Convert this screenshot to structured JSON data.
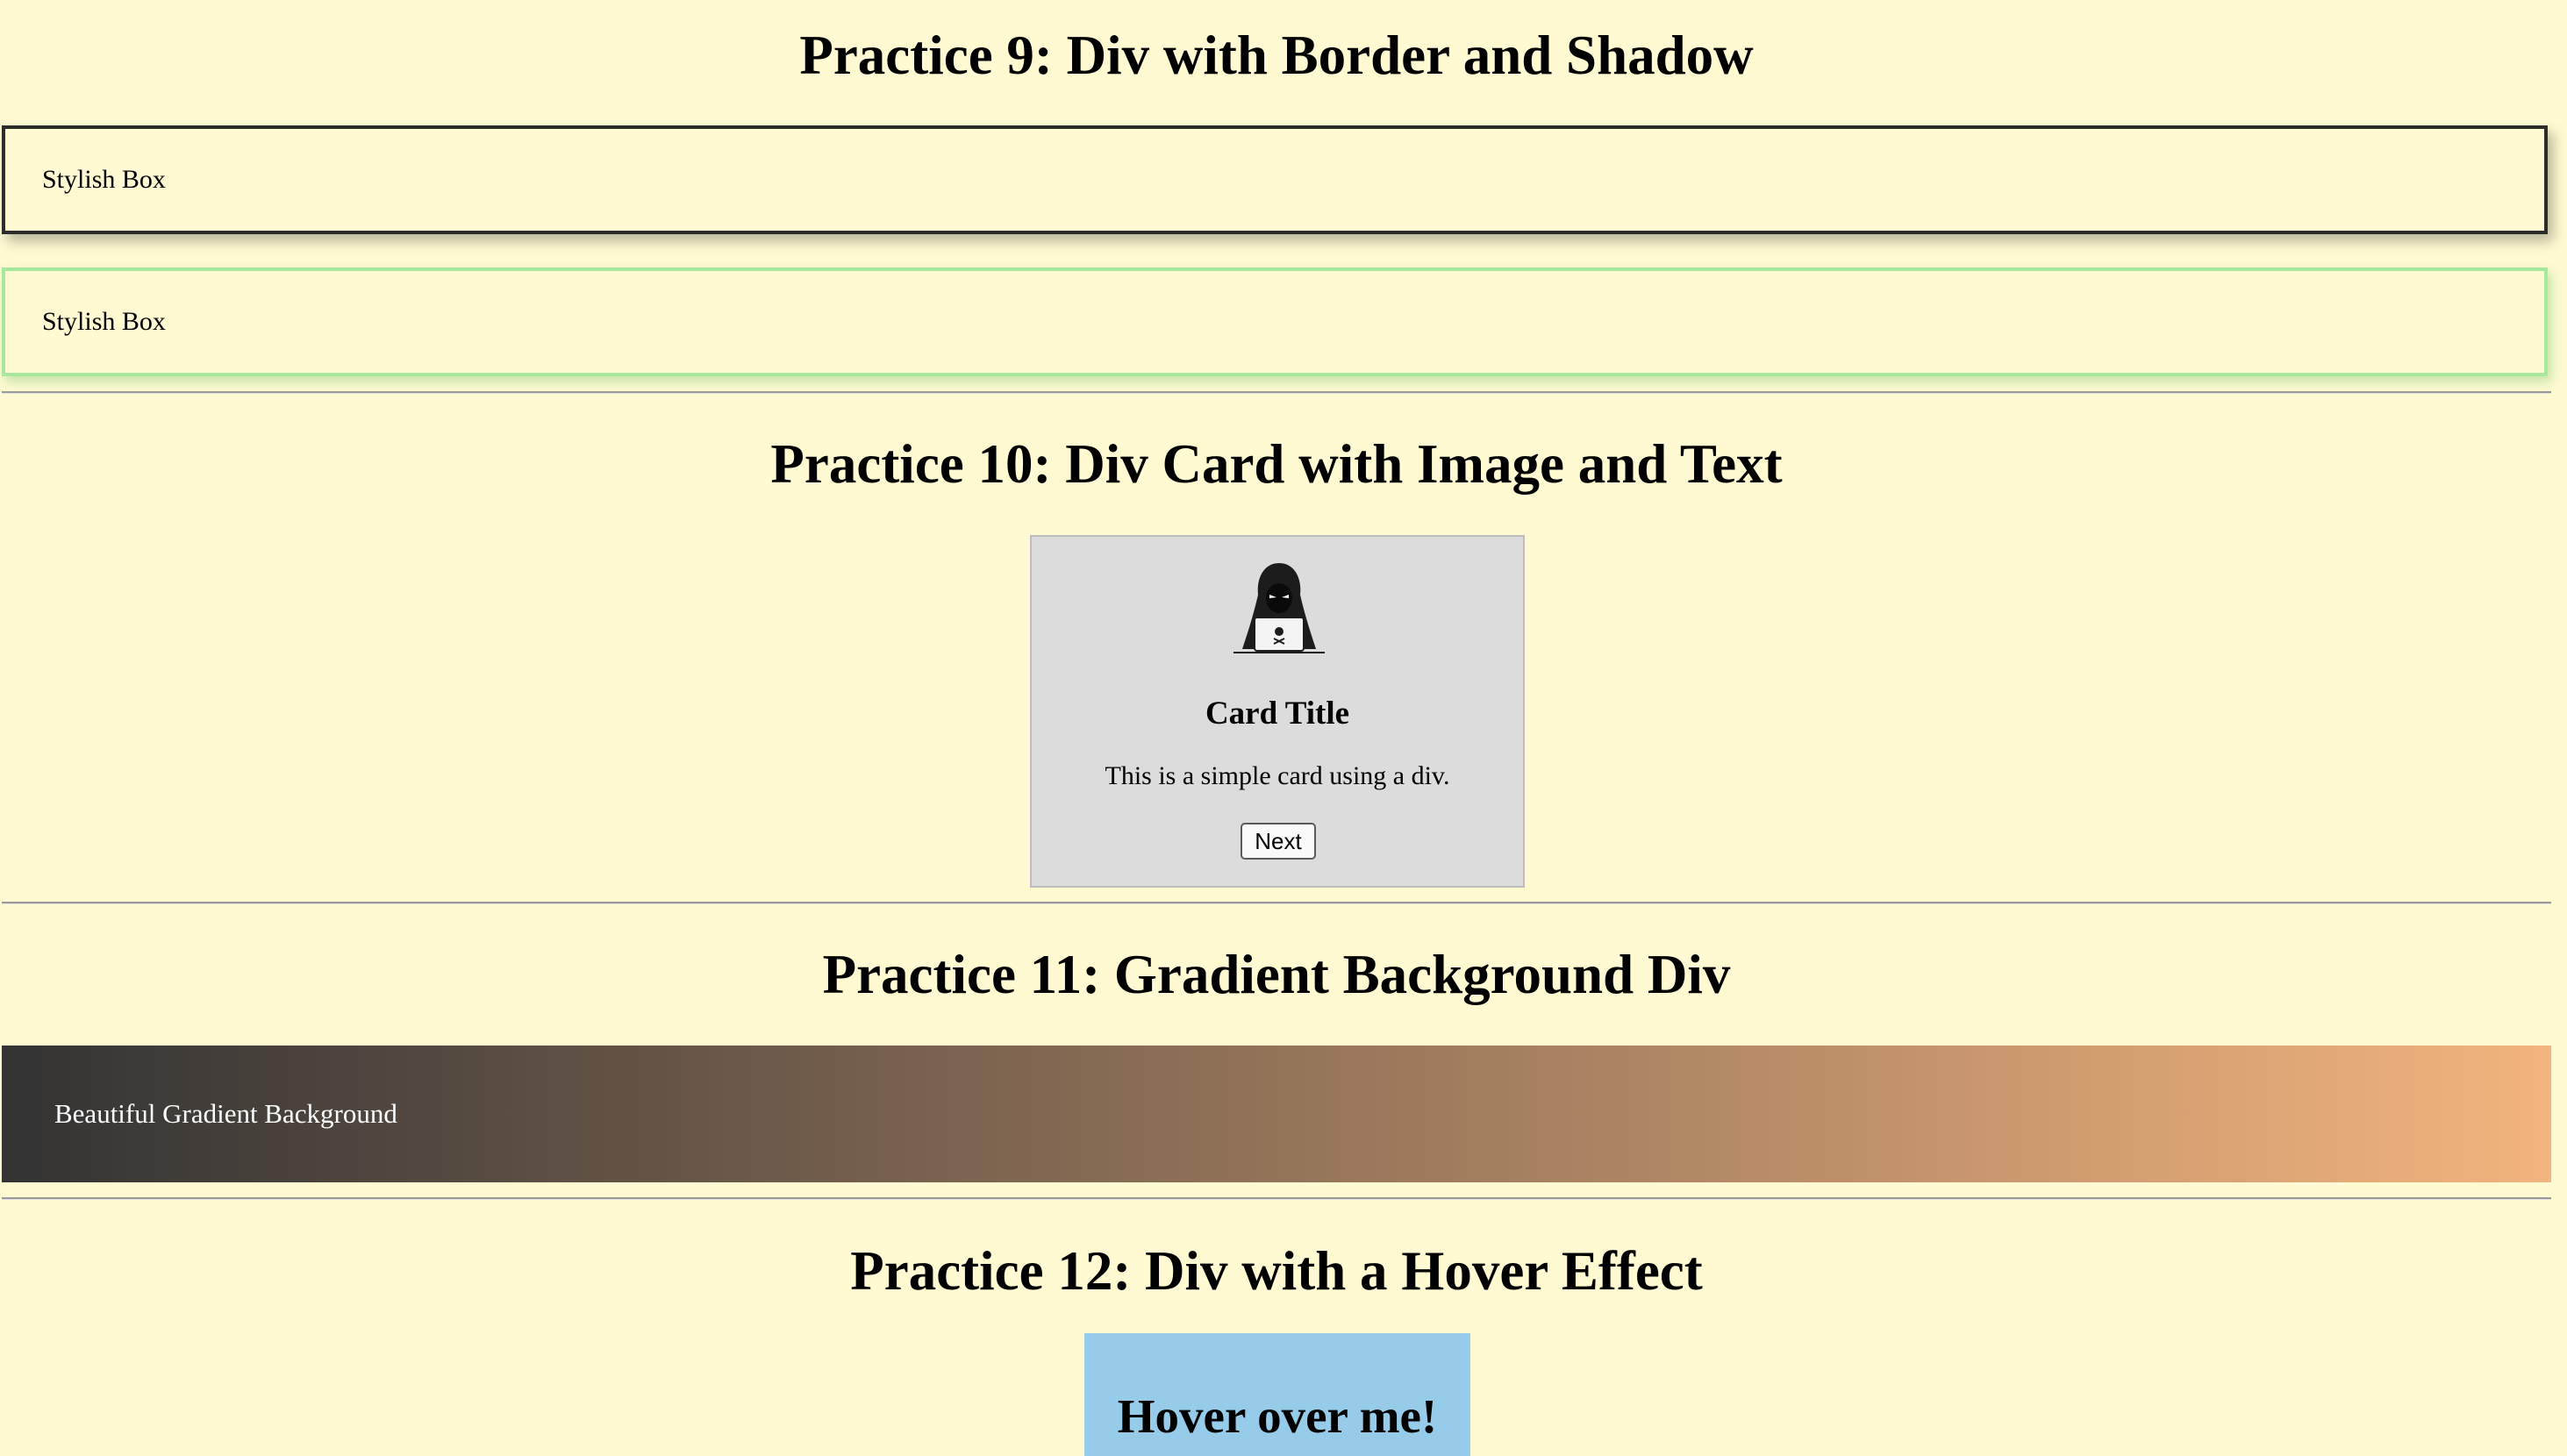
{
  "sections": {
    "practice9": {
      "heading": "Practice 9: Div with Border and Shadow",
      "box1_text": "Stylish Box",
      "box2_text": "Stylish Box"
    },
    "practice10": {
      "heading": "Practice 10: Div Card with Image and Text",
      "card": {
        "image_icon": "hooded-hacker-laptop-icon",
        "title": "Card Title",
        "text": "This is a simple card using a div.",
        "button_label": "Next"
      }
    },
    "practice11": {
      "heading": "Practice 11: Gradient Background Div",
      "text": "Beautiful Gradient Background",
      "gradient_colors": [
        "#333333",
        "#f3b47e"
      ]
    },
    "practice12": {
      "heading": "Practice 12: Div with a Hover Effect",
      "box_text": "Hover over me!"
    }
  },
  "colors": {
    "page_background": "#fffad2",
    "box1_border": "#2c2c2c",
    "box2_border": "#a6e89c",
    "card_background": "#dcdcdc",
    "hover_box_background": "#96cce9"
  }
}
